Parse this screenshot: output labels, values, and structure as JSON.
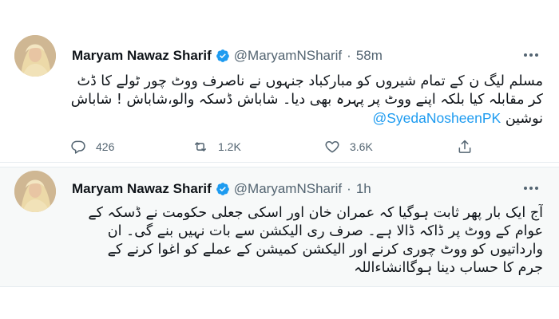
{
  "tweets": [
    {
      "author_name": "Maryam Nawaz Sharif",
      "handle": "@MaryamNSharif",
      "separator": "·",
      "time": "58m",
      "lines": [
        "مسلم لیگ ن کے تمام شیروں کو مبارکباد جنہوں نے ناصرف ووٹ چور ٹولے کا ڈٹ",
        "کر مقابلہ کیا بلکہ اپنے ووٹ پر پہرہ بھی دیا۔ شاباش ڈسکہ والو،شاباش ! شاباش",
        "نوشین"
      ],
      "mention": "@SyedaNosheenPK",
      "reply_count": "426",
      "retweet_count": "1.2K",
      "like_count": "3.6K"
    },
    {
      "author_name": "Maryam Nawaz Sharif",
      "handle": "@MaryamNSharif",
      "separator": "·",
      "time": "1h",
      "lines": [
        "آج ایک بار پھر ثابت ہوگیا کہ عمران خان اور اسکی جعلی حکومت نے ڈسکہ کے",
        "عوام کے ووٹ پر ڈاکہ ڈالا ہے۔ صرف ری الیکشن سے بات نہیں بنے گی۔ ان",
        "وارداتیوں کو ووٹ چوری کرنے اور الیکشن کمیشن کے عملے کو اغوا کرنے کے",
        "جرم کا حساب دینا ہوگاانشاءاللہ"
      ]
    }
  ],
  "icons": {
    "verified": "verified-badge-icon",
    "more": "more-options-icon",
    "reply": "reply-icon",
    "retweet": "retweet-icon",
    "like": "like-heart-icon",
    "share": "share-icon"
  },
  "colors": {
    "accent": "#1d9bf0",
    "secondary_text": "#536471",
    "highlight_bg": "#f7f9f9"
  }
}
